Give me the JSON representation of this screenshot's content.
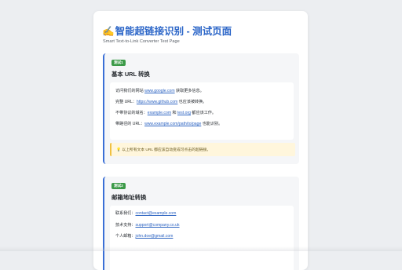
{
  "header": {
    "pen_emoji": "✍️",
    "title": "智能超链接识别 - 测试页面",
    "subtitle": "Smart Text-to-Link Converter Test Page"
  },
  "sections": [
    {
      "tag": "测试1",
      "title": "基本 URL 转换",
      "lines": [
        {
          "pre": "访问我们的网站 ",
          "link": "www.google.com",
          "post": " 获取更多信息。"
        },
        {
          "pre": "完整 URL：",
          "link": "https://www.github.com",
          "post": " 也应该被转换。"
        },
        {
          "pre": "不带协议的域名：",
          "link": "example.com",
          "mid": " 和 ",
          "link2": "test.org",
          "post": " 都应该工作。"
        },
        {
          "pre": "带路径的 URL：",
          "link": "www.example.com/path/to/page",
          "post": " 也能识别。"
        }
      ],
      "note": "💡 以上所有文本 URL 都应该自动变成可点击的超链接。"
    },
    {
      "tag": "测试2",
      "title": "邮箱地址转换",
      "lines": [
        {
          "pre": "联系我们：",
          "link": "contact@example.com"
        },
        {
          "pre": "技术支持：",
          "link": "support@company.co.uk"
        },
        {
          "pre": "个人邮箱：",
          "link": "john.doe@gmail.com"
        }
      ]
    }
  ],
  "colors": {
    "accent": "#2c66c8",
    "tag_green": "#3c9a48",
    "link": "#2d64c2",
    "note_bg": "#fff6dc"
  }
}
